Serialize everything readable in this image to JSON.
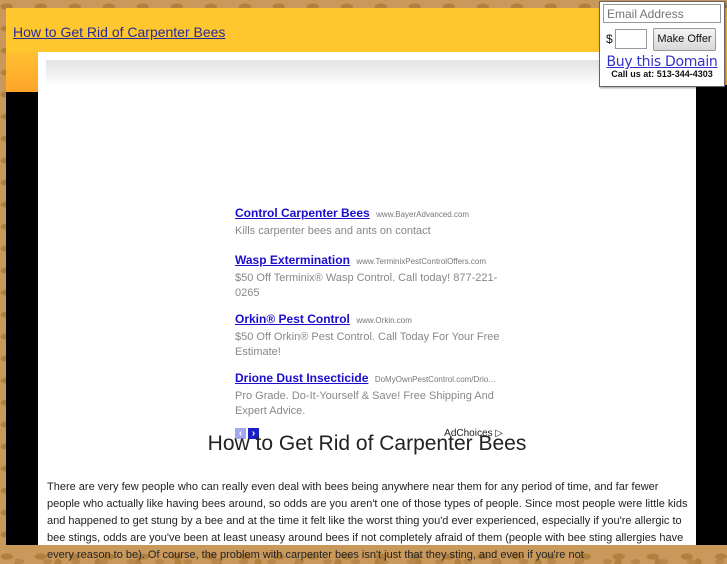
{
  "header": {
    "site_title": "How to Get Rid of Carpenter Bees"
  },
  "offer_box": {
    "email_placeholder": "Email Address",
    "currency_symbol": "$",
    "amount_value": "",
    "make_offer_label": "Make Offer",
    "buy_domain_label": "Buy this Domain",
    "call_us_text": "Call us at: 513-344-4303"
  },
  "ads": {
    "items": [
      {
        "title": "Control Carpenter Bees",
        "url": "www.BayerAdvanced.com",
        "description": "Kills carpenter bees and ants on contact"
      },
      {
        "title": "Wasp Extermination",
        "url": "www.TerminixPestControlOffers.com",
        "description": "$50 Off Terminix® Wasp Control. Call today! 877-221-0265"
      },
      {
        "title": "Orkin® Pest Control",
        "url": "www.Orkin.com",
        "description": "$50 Off Orkin® Pest Control. Call Today For Your Free Estimate!"
      },
      {
        "title": "Drione Dust Insecticide",
        "url": "DoMyOwnPestControl.com/Drio…",
        "description": "Pro Grade. Do-It-Yourself & Save! Free Shipping And Expert Advice."
      }
    ],
    "prev_icon": "‹",
    "next_icon": "›",
    "adchoices_label": "AdChoices ▷"
  },
  "article": {
    "title": "How to Get Rid of Carpenter Bees",
    "body": "There are very few people who can really even deal with bees being anywhere near them for any period of time, and far fewer people who actually like having bees around, so odds are you aren't one of those types of people. Since most people were little kids and happened to get stung by a bee and at the time it felt like the worst thing you'd ever experienced, especially if you're allergic to bee stings, odds are you've been at least uneasy around bees if not completely afraid of them (people with bee sting allergies have every reason to be). Of course, the problem with carpenter bees isn't just that they sting, and even if you're not"
  },
  "colors": {
    "header_yellow": "#ffc72e",
    "link_blue": "#1a0dcc",
    "background_tan": "#c9995c"
  }
}
